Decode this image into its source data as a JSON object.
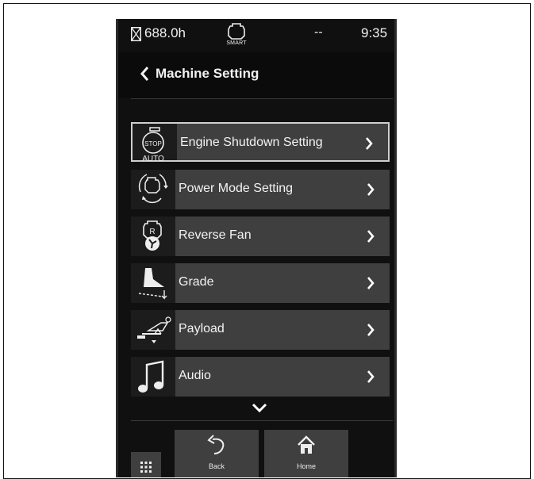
{
  "status_bar": {
    "hours": "688.0h",
    "mode_label": "SMART",
    "dash": "--",
    "time": "9:35"
  },
  "header": {
    "title": "Machine Setting"
  },
  "menu": {
    "items": [
      {
        "label": "Engine Shutdown Setting",
        "icon": "engine-auto-stop-icon",
        "selected": true
      },
      {
        "label": "Power Mode Setting",
        "icon": "power-mode-icon",
        "selected": false
      },
      {
        "label": "Reverse Fan",
        "icon": "reverse-fan-icon",
        "selected": false
      },
      {
        "label": "Grade",
        "icon": "grade-icon",
        "selected": false
      },
      {
        "label": "Payload",
        "icon": "payload-icon",
        "selected": false
      },
      {
        "label": "Audio",
        "icon": "audio-icon",
        "selected": false
      }
    ],
    "icon_badges": {
      "stop": "STOP",
      "auto": "AUTO",
      "reverse": "R"
    }
  },
  "nav": {
    "back_label": "Back",
    "home_label": "Home"
  },
  "colors": {
    "background": "#101010",
    "item": "#3f3f3f",
    "icon_bg": "#1c1c1c",
    "text": "#f3f3f3",
    "selected_border": "#cfcfcf"
  }
}
